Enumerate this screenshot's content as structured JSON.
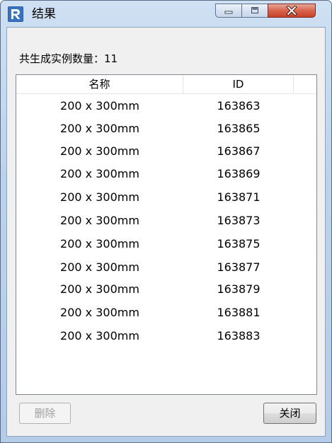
{
  "window": {
    "title": "结果",
    "controls": {
      "minimize_icon": "minimize-icon",
      "maximize_icon": "maximize-icon",
      "close_icon": "close-icon"
    },
    "app_icon": "revit-icon"
  },
  "summary": {
    "label": "共生成实例数量：11"
  },
  "table": {
    "columns": [
      "名称",
      "ID"
    ],
    "rows": [
      {
        "name": "200 x 300mm",
        "id": "163863"
      },
      {
        "name": "200 x 300mm",
        "id": "163865"
      },
      {
        "name": "200 x 300mm",
        "id": "163867"
      },
      {
        "name": "200 x 300mm",
        "id": "163869"
      },
      {
        "name": "200 x 300mm",
        "id": "163871"
      },
      {
        "name": "200 x 300mm",
        "id": "163873"
      },
      {
        "name": "200 x 300mm",
        "id": "163875"
      },
      {
        "name": "200 x 300mm",
        "id": "163877"
      },
      {
        "name": "200 x 300mm",
        "id": "163879"
      },
      {
        "name": "200 x 300mm",
        "id": "163881"
      },
      {
        "name": "200 x 300mm",
        "id": "163883"
      }
    ]
  },
  "buttons": {
    "delete_label": "删除",
    "close_label": "关闭"
  },
  "colors": {
    "titlebar": "#bcd2ec",
    "close_button": "#c84227",
    "client_background": "#f0f0f0",
    "disabled_text": "#a0a0a0"
  }
}
